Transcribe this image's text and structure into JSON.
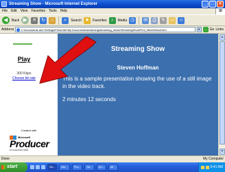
{
  "window": {
    "title": "Streaming Show - Microsoft Internet Explorer",
    "controls": [
      "_",
      "□",
      "×"
    ]
  },
  "menubar": [
    "File",
    "Edit",
    "View",
    "Favorites",
    "Tools",
    "Help"
  ],
  "toolbar": {
    "back_label": "Back",
    "search_label": "Search",
    "favorites_label": "Favorites",
    "media_label": "Media"
  },
  "address": {
    "label": "Address",
    "value": "C:\\Documents and Settings\\Presenter\\My Documents\\streaming\\streaming_show\\StreamingShowPrint_files\\Default.htm",
    "go_label": "Go",
    "links_label": "Links"
  },
  "left_pane": {
    "play_label": "Play",
    "bandwidth": "300 Kbps",
    "choose_bit_rate": "Choose bit rate",
    "created_with": "Created with",
    "logo_company": "Microsoft",
    "logo_product": "Producer",
    "logo_suffix": "for PowerPoint 2003"
  },
  "right_pane": {
    "title": "Streaming Show",
    "presenter": "Steven Hoffman",
    "description": "This is a sample presentation showing the use of a still image in the video track.",
    "duration": "2 minutes 12 seconds",
    "background_color": "#3b6fae"
  },
  "statusbar": {
    "text": "Done",
    "zone": "My Computer"
  },
  "taskbar": {
    "start_label": "start",
    "tasks": [
      "Str...",
      "Mic...",
      "Pro...",
      "Str...",
      "Do...",
      "Mi..."
    ],
    "clock": "9:41 AM"
  },
  "overlay": {
    "arrow_color": "#e01010"
  }
}
